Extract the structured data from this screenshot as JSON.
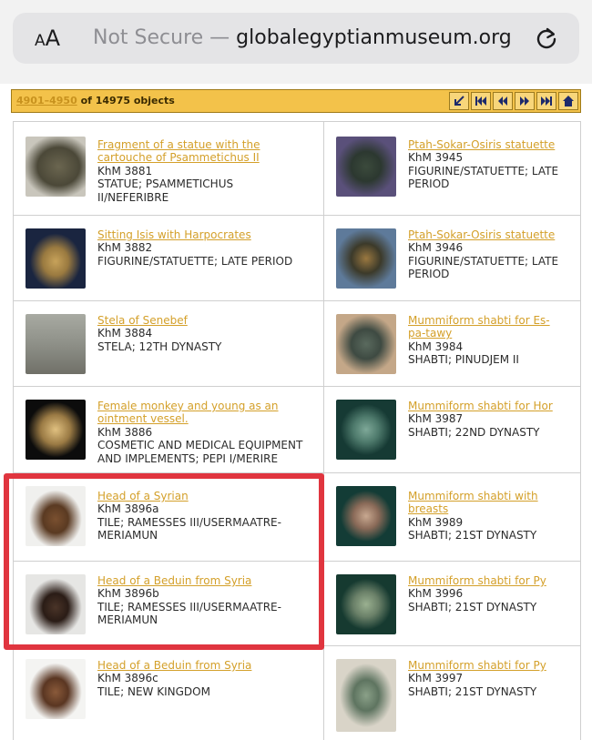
{
  "browser": {
    "text_size_label_small": "A",
    "text_size_label_big": "A",
    "security": "Not Secure",
    "separator": " — ",
    "domain": "globalegyptianmuseum.org"
  },
  "pager": {
    "range": "4901–4950",
    "suffix": " of 14975 objects"
  },
  "items": [
    {
      "title_lines": [
        "Fragment of a statue with the",
        "cartouche of Psammetichus II"
      ],
      "id": "KhM 3881",
      "desc_lines": [
        "STATUE; PSAMMETICHUS",
        "II/NEFERIBRE"
      ]
    },
    {
      "title_lines": [
        "Ptah-Sokar-Osiris statuette"
      ],
      "id": "KhM 3945",
      "desc_lines": [
        "FIGURINE/STATUETTE; LATE",
        "PERIOD"
      ]
    },
    {
      "title_lines": [
        "Sitting Isis with Harpocrates"
      ],
      "id": "KhM 3882",
      "desc_lines": [
        "FIGURINE/STATUETTE; LATE PERIOD"
      ]
    },
    {
      "title_lines": [
        "Ptah-Sokar-Osiris statuette"
      ],
      "id": "KhM 3946",
      "desc_lines": [
        "FIGURINE/STATUETTE; LATE",
        "PERIOD"
      ]
    },
    {
      "title_lines": [
        "Stela of Senebef"
      ],
      "id": "KhM 3884",
      "desc_lines": [
        "STELA; 12TH DYNASTY"
      ]
    },
    {
      "title_lines": [
        "Mummiform shabti for Es-",
        "pa-tawy"
      ],
      "id": "KhM 3984",
      "desc_lines": [
        "SHABTI; PINUDJEM II"
      ]
    },
    {
      "title_lines": [
        "Female monkey and young as an",
        "ointment vessel."
      ],
      "id": "KhM 3886",
      "desc_lines": [
        "COSMETIC AND MEDICAL EQUIPMENT",
        "AND IMPLEMENTS; PEPI I/MERIRE"
      ]
    },
    {
      "title_lines": [
        "Mummiform shabti for Hor"
      ],
      "id": "KhM 3987",
      "desc_lines": [
        "SHABTI; 22ND DYNASTY"
      ]
    },
    {
      "title_lines": [
        "Head of a Syrian"
      ],
      "id": "KhM 3896a",
      "desc_lines": [
        "TILE; RAMESSES III/USERMAATRE-",
        "MERIAMUN"
      ]
    },
    {
      "title_lines": [
        "Mummiform shabti with",
        "breasts"
      ],
      "id": "KhM 3989",
      "desc_lines": [
        "SHABTI; 21ST DYNASTY"
      ]
    },
    {
      "title_lines": [
        "Head of a Beduin from Syria"
      ],
      "id": "KhM 3896b",
      "desc_lines": [
        "TILE; RAMESSES III/USERMAATRE-",
        "MERIAMUN"
      ]
    },
    {
      "title_lines": [
        "Mummiform shabti for Py"
      ],
      "id": "KhM 3996",
      "desc_lines": [
        "SHABTI; 21ST DYNASTY"
      ]
    },
    {
      "title_lines": [
        "Head of a Beduin from Syria"
      ],
      "id": "KhM 3896c",
      "desc_lines": [
        "TILE; NEW KINGDOM"
      ]
    },
    {
      "title_lines": [
        "Mummiform shabti for Py"
      ],
      "id": "KhM 3997",
      "desc_lines": [
        "SHABTI; 21ST DYNASTY"
      ]
    }
  ],
  "colors": {
    "link": "#d4a02a",
    "pager_bg": "#f3c24a",
    "highlight": "#e0353f"
  }
}
